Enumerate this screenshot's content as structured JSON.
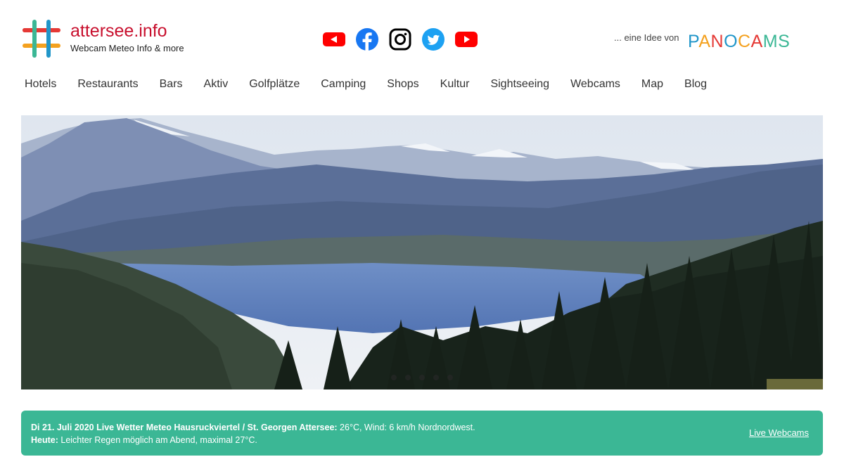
{
  "header": {
    "logo_title": "attersee.info",
    "logo_subtitle": "Webcam Meteo Info & more",
    "idea_text": "... eine Idee von",
    "partner": {
      "letters": [
        "P",
        "A",
        "N",
        "O",
        "C",
        "A",
        "M",
        "S"
      ],
      "colors": [
        "#2196c9",
        "#f4a11f",
        "#e53935",
        "#2196c9",
        "#f4a11f",
        "#e53935",
        "#3bb795",
        "#3bb795"
      ]
    },
    "socials": [
      {
        "icon": "youtube-small-icon",
        "color": "#ff0000"
      },
      {
        "icon": "facebook-icon",
        "color": "#1877f2"
      },
      {
        "icon": "instagram-icon",
        "color": "#000000"
      },
      {
        "icon": "twitter-icon",
        "color": "#1da1f2"
      },
      {
        "icon": "youtube-icon",
        "color": "#ff0000"
      }
    ]
  },
  "nav": {
    "items": [
      "Hotels",
      "Restaurants",
      "Bars",
      "Aktiv",
      "Golfplätze",
      "Camping",
      "Shops",
      "Kultur",
      "Sightseeing",
      "Webcams",
      "Map",
      "Blog"
    ]
  },
  "slider": {
    "dot_count": 5
  },
  "weather": {
    "line1_bold": "Di 21. Juli 2020 Live Wetter Meteo Hausruckviertel / St. Georgen Attersee:",
    "line1_text": " 26°C, Wind: 6 km/h Nordnordwest.",
    "line2_bold": "Heute:",
    "line2_text": " Leichter Regen möglich am Abend, maximal 27°C.",
    "link_label": "Live Webcams",
    "bg_color": "#3bb795"
  }
}
